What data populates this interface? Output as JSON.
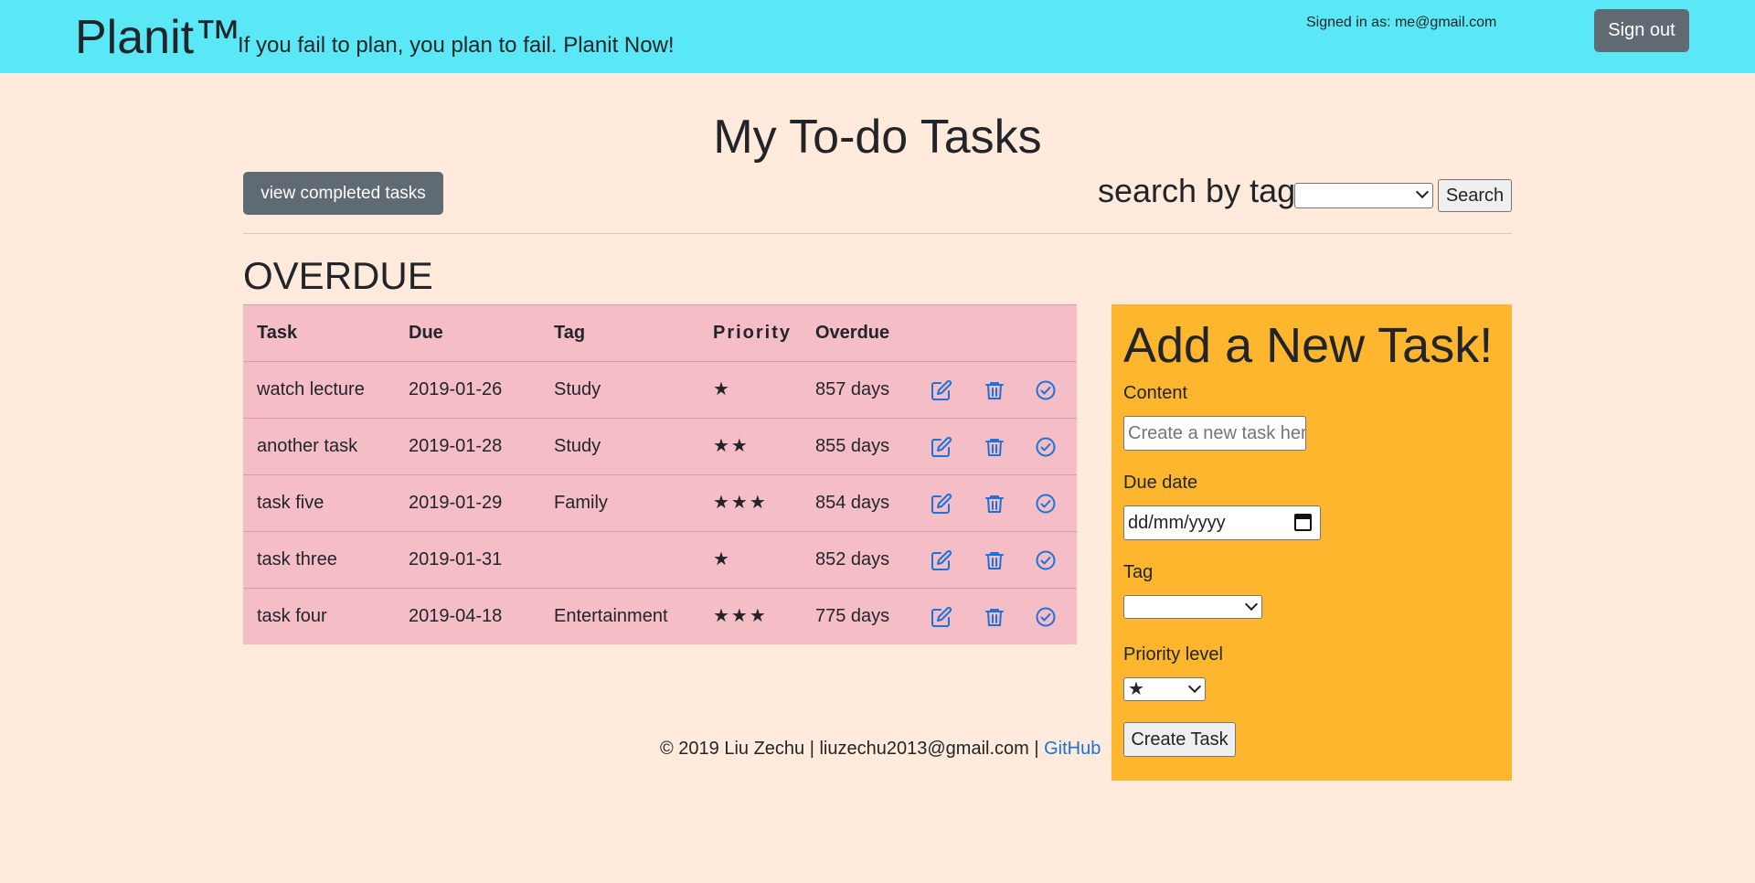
{
  "header": {
    "brand": "Planit™",
    "tagline": "If you fail to plan, you plan to fail. Planit Now!",
    "signed_in": "Signed in as: me@gmail.com",
    "sign_out": "Sign out"
  },
  "main": {
    "title": "My To-do Tasks",
    "view_completed": "view completed tasks",
    "search_label": "search by tag",
    "search_value": "",
    "search_button": "Search",
    "section_title": "OVERDUE"
  },
  "table": {
    "headers": [
      "Task",
      "Due",
      "Tag",
      "Priority",
      "Overdue"
    ],
    "rows": [
      {
        "task": "watch lecture",
        "due": "2019-01-26",
        "tag": "Study",
        "priority": "★",
        "overdue": "857 days"
      },
      {
        "task": "another task",
        "due": "2019-01-28",
        "tag": "Study",
        "priority": "★★",
        "overdue": "855 days"
      },
      {
        "task": "task five",
        "due": "2019-01-29",
        "tag": "Family",
        "priority": "★★★",
        "overdue": "854 days"
      },
      {
        "task": "task three",
        "due": "2019-01-31",
        "tag": "",
        "priority": "★",
        "overdue": "852 days"
      },
      {
        "task": "task four",
        "due": "2019-04-18",
        "tag": "Entertainment",
        "priority": "★★★",
        "overdue": "775 days"
      }
    ],
    "icons": {
      "edit": "edit-icon",
      "delete": "trash-icon",
      "complete": "check-circle-icon"
    }
  },
  "add_task": {
    "title": "Add a New Task!",
    "content_label": "Content",
    "content_placeholder": "Create a new task here",
    "due_label": "Due date",
    "due_placeholder": "dd/mm/yyyy",
    "tag_label": "Tag",
    "tag_value": "",
    "priority_label": "Priority level",
    "priority_value": "★",
    "create_button": "Create Task"
  },
  "footer": {
    "text": "© 2019 Liu Zechu | liuzechu2013@gmail.com | ",
    "link": "GitHub"
  },
  "colors": {
    "header_bg": "#5ae8f6",
    "page_bg": "#ffeadb",
    "table_bg": "#f5bec6",
    "panel_bg": "#fdb62d",
    "button_bg": "#5f6a73",
    "icon": "#1a73d8",
    "link": "#1a73d8"
  }
}
